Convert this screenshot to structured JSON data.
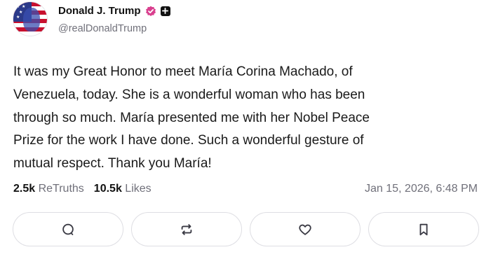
{
  "author": {
    "display_name": "Donald J. Trump",
    "handle": "@realDonaldTrump"
  },
  "post": {
    "text": "It was my Great Honor to meet María Corina Machado, of\nVenezuela, today. She is a wonderful woman who has been\nthrough so much. María presented me with her Nobel Peace\nPrize for the work I have done. Such a wonderful gesture of\nmutual respect. Thank you María!"
  },
  "stats": {
    "retruths_count": "2.5k",
    "retruths_label": "ReTruths",
    "likes_count": "10.5k",
    "likes_label": "Likes",
    "timestamp": "Jan 15, 2026, 6:48 PM"
  },
  "actions": [
    {
      "icon": "reply-icon"
    },
    {
      "icon": "retruth-icon"
    },
    {
      "icon": "like-heart-icon"
    },
    {
      "icon": "bookmark-icon"
    }
  ],
  "colors": {
    "verified_badge": "#d93f8e",
    "muted_text": "#70707a",
    "border": "#dedee3"
  }
}
